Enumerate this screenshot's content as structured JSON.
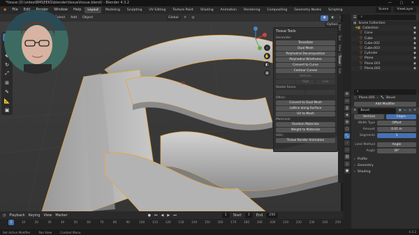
{
  "window": {
    "title": "*tissue (D:\\video\\BMSEEKS\\blender\\tissue\\tissue.blend) - Blender 4.3.2",
    "controls": "— ▢ ✕"
  },
  "menubar": {
    "menus": [
      "File",
      "Edit",
      "Render",
      "Window",
      "Help"
    ],
    "workspaces": [
      "Layout",
      "Modeling",
      "Sculpting",
      "UV Editing",
      "Texture Paint",
      "Shading",
      "Animation",
      "Rendering",
      "Compositing",
      "Geometry Nodes",
      "Scripting"
    ],
    "active_workspace": "Layout",
    "scene": "Scene",
    "view_layer": "ViewLayer"
  },
  "viewport": {
    "menus": [
      "Select",
      "Add",
      "Object"
    ],
    "transform": "Global",
    "options": "Options"
  },
  "tissue_panel": {
    "title": "Tissue Tools",
    "generate_label": "Generate:",
    "tessellate": "Tessellate",
    "dual_mesh": "Dual Mesh",
    "polyhedral_decomposition": "Polyhedral Decomposition",
    "polyhedral_wireframe": "Polyhedral Wireframe",
    "convert_to_curve": "Convert to Curve",
    "contour_curves": "Contour Curves",
    "refresh": "Refresh",
    "low": "Low",
    "high": "High",
    "rotate_faces_label": "Rotate Faces:",
    "other_label": "Other:",
    "convert_to_dual_mesh": "Convert to Dual Mesh",
    "lattice_along_surface": "Lattice along Surface",
    "uv_to_mesh": "UV to Mesh",
    "materials_label": "Materials:",
    "random_materials": "Random Materials",
    "weight_to_materials": "Weight to Materials",
    "utils_label": "Utils:",
    "tissue_render_animation": "Tissue Render Animation"
  },
  "sidebar_tabs": [
    "Item",
    "Tool",
    "View",
    "Tissue",
    "Edit"
  ],
  "outliner": {
    "title": "Scene Collection",
    "items": [
      {
        "name": "Collection",
        "type": "collection"
      },
      {
        "name": "Cone",
        "type": "object"
      },
      {
        "name": "Cube",
        "type": "object"
      },
      {
        "name": "Cube.002",
        "type": "object"
      },
      {
        "name": "Cube.003",
        "type": "object"
      },
      {
        "name": "Cylinder",
        "type": "object"
      },
      {
        "name": "Plane",
        "type": "object"
      },
      {
        "name": "Plane.001",
        "type": "object"
      },
      {
        "name": "Plane.002",
        "type": "object"
      }
    ]
  },
  "properties": {
    "object_name": "Plane.005",
    "modifier_name": "Bevel",
    "add_modifier": "Add Modifier",
    "mode_vertices": "Vertices",
    "mode_edges": "Edges",
    "width_type_label": "Width Type",
    "width_type": "Offset",
    "amount_label": "Amount",
    "amount": "0.01 m",
    "segments_label": "Segments",
    "segments": "3",
    "limit_method_label": "Limit Method",
    "limit_method": "Angle",
    "angle_label": "Angle",
    "angle": "30°",
    "profile": "Profile",
    "geometry": "Geometry",
    "shading": "Shading"
  },
  "timeline": {
    "menus": [
      "Playback",
      "Keying",
      "View",
      "Marker"
    ],
    "current_frame": "1",
    "start_label": "Start",
    "start": "1",
    "end_label": "End",
    "end": "250",
    "ticks": [
      "1",
      "10",
      "20",
      "30",
      "40",
      "50",
      "60",
      "70",
      "80",
      "90",
      "100",
      "110",
      "120",
      "130",
      "140",
      "150",
      "160",
      "170",
      "180",
      "190",
      "200",
      "210",
      "220",
      "230",
      "240",
      "250"
    ]
  },
  "statusbar": {
    "left": "Set Active Modifier",
    "middle": "Pan View",
    "right": "Context Menu",
    "version": "4.3.2"
  },
  "colors": {
    "accent": "#4772b3",
    "selection_outline": "#e6a53b",
    "mesh": "#b9b9b9"
  }
}
